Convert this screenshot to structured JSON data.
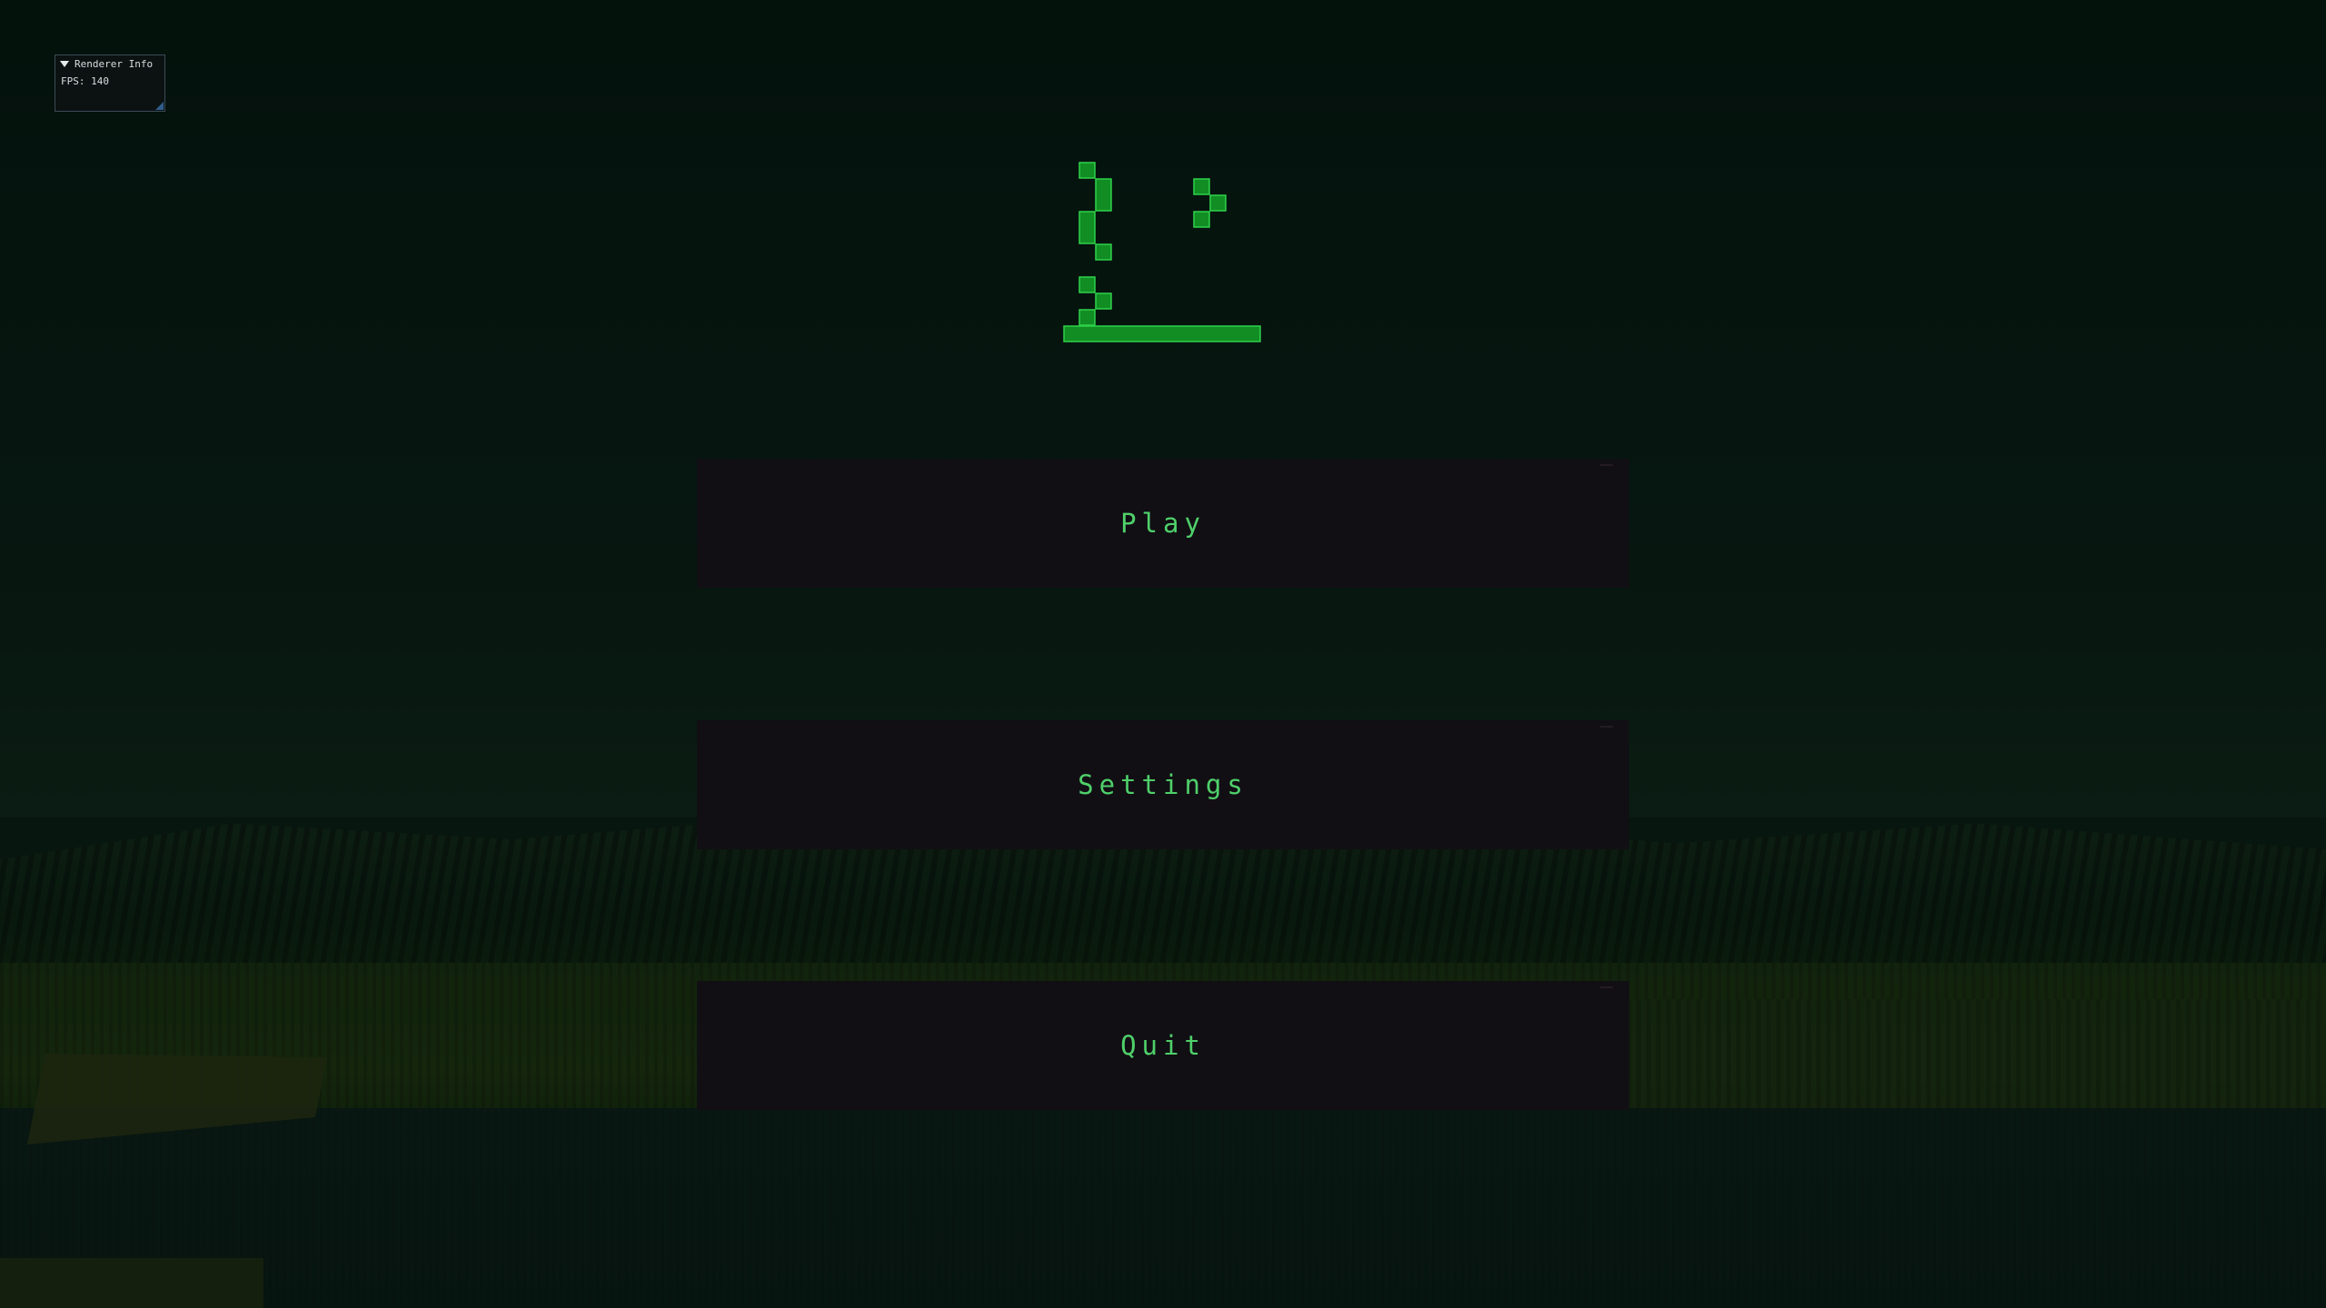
{
  "debug_window": {
    "title": "Renderer Info",
    "fps_text": "FPS: 140",
    "collapse_icon": "triangle-down-icon"
  },
  "logo": {
    "description_icon": "pixel-logo-icon",
    "color": "#118d24",
    "outline_color": "#2fd24a"
  },
  "menu": {
    "play_label": "Play",
    "settings_label": "Settings",
    "quit_label": "Quit",
    "text_color": "#4fd06a",
    "button_color": "#110f14"
  }
}
